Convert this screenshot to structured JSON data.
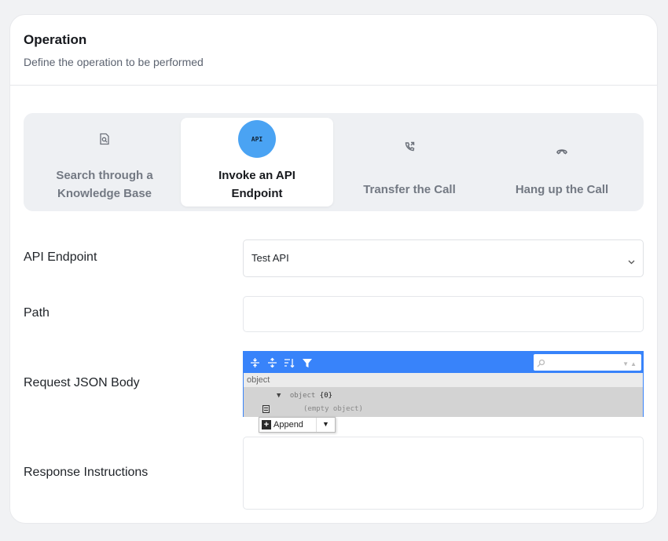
{
  "header": {
    "title": "Operation",
    "subtitle": "Define the operation to be performed"
  },
  "operations": [
    {
      "label_line1": "Search through a",
      "label_line2": "Knowledge Base",
      "icon": "search-document-icon",
      "selected": false
    },
    {
      "label_line1": "Invoke an API",
      "label_line2": "Endpoint",
      "icon": "api-icon",
      "icon_text": "API",
      "selected": true
    },
    {
      "label_line1": "Transfer the Call",
      "label_line2": "",
      "icon": "phone-forward-icon",
      "selected": false
    },
    {
      "label_line1": "Hang up the Call",
      "label_line2": "",
      "icon": "phone-hangup-icon",
      "selected": false
    }
  ],
  "form": {
    "api_endpoint": {
      "label": "API Endpoint",
      "value": "Test API"
    },
    "path": {
      "label": "Path",
      "value": ""
    },
    "request_body": {
      "label": "Request JSON Body",
      "nav_path": "object",
      "root_key": "object",
      "root_count": "{0}",
      "empty_text": "(empty object)",
      "append_label": "Append"
    },
    "response_instructions": {
      "label": "Response Instructions",
      "value": ""
    }
  },
  "colors": {
    "accent": "#4aa3f3",
    "json_editor_blue": "#3883fa",
    "card_background": "#ffffff",
    "page_background": "#f1f2f4"
  }
}
